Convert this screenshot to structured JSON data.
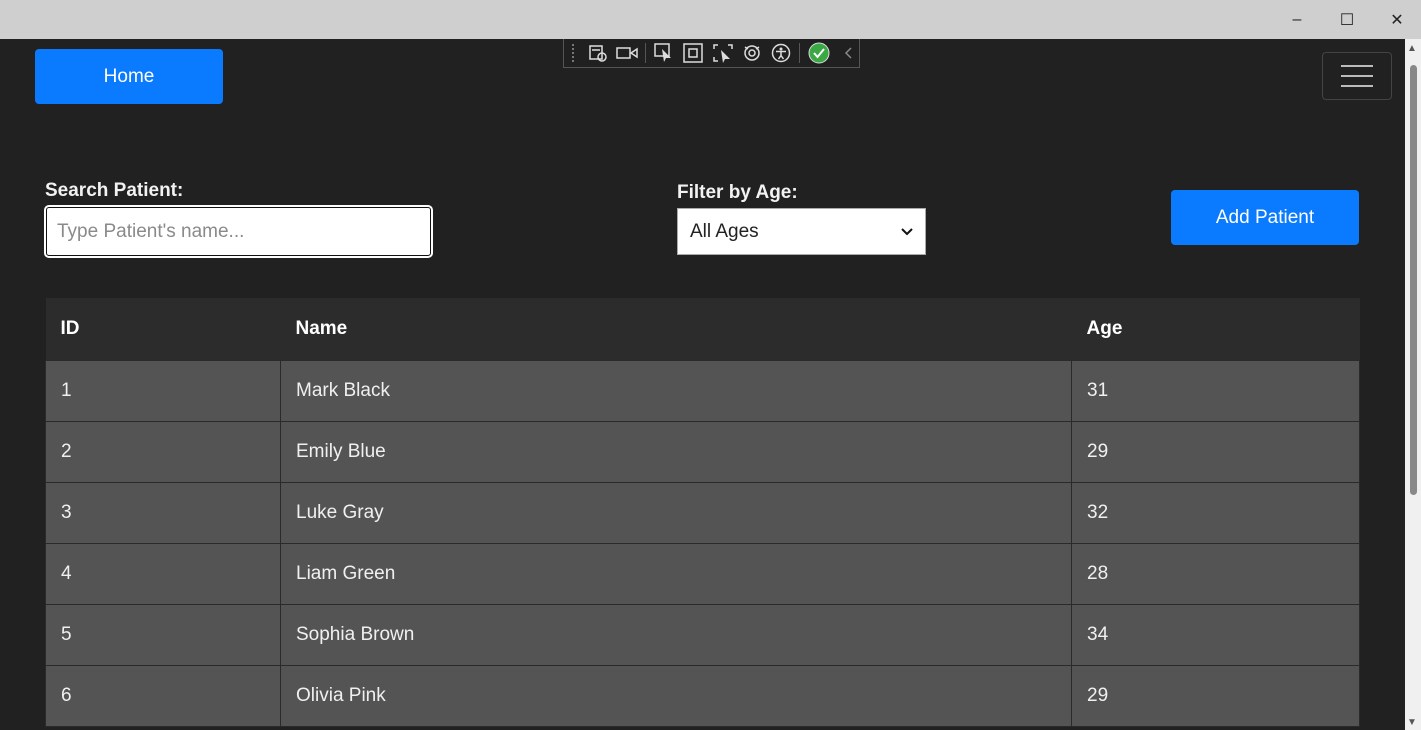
{
  "window": {
    "minimize": "–",
    "maximize": "☐",
    "close": "✕"
  },
  "nav": {
    "home_label": "Home"
  },
  "search": {
    "label": "Search Patient:",
    "placeholder": "Type Patient's name...",
    "value": ""
  },
  "filter": {
    "label": "Filter by Age:",
    "selected": "All Ages"
  },
  "actions": {
    "add_label": "Add Patient"
  },
  "table": {
    "headers": [
      "ID",
      "Name",
      "Age"
    ],
    "rows": [
      [
        "1",
        "Mark Black",
        "31"
      ],
      [
        "2",
        "Emily Blue",
        "29"
      ],
      [
        "3",
        "Luke Gray",
        "32"
      ],
      [
        "4",
        "Liam Green",
        "28"
      ],
      [
        "5",
        "Sophia Brown",
        "34"
      ],
      [
        "6",
        "Olivia Pink",
        "29"
      ]
    ]
  },
  "colors": {
    "primary": "#0a7bff",
    "background": "#212121",
    "table_header": "#2c2c2c",
    "table_row": "#545454"
  }
}
